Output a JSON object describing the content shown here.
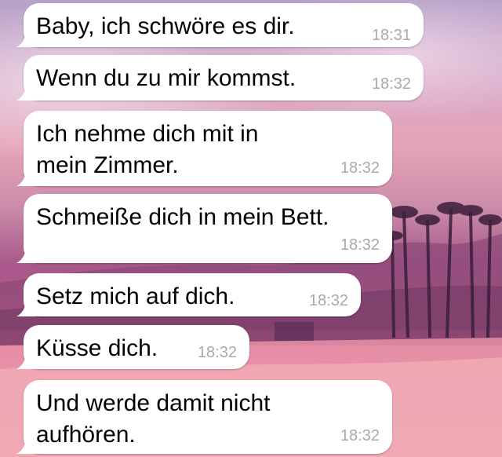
{
  "chat": {
    "messages": [
      {
        "text": "Baby, ich schwöre es dir.",
        "time": "18:31"
      },
      {
        "text": "Wenn du zu mir kommst.",
        "time": "18:32"
      },
      {
        "text": "Ich nehme dich mit in mein Zimmer.",
        "time": "18:32"
      },
      {
        "text": "Schmeiße dich in mein Bett.",
        "time": "18:32"
      },
      {
        "text": "Setz mich auf dich.",
        "time": "18:32"
      },
      {
        "text": "Küsse dich.",
        "time": "18:32"
      },
      {
        "text": "Und werde damit nicht aufhören.",
        "time": "18:32"
      }
    ]
  },
  "wallpaper": {
    "description_colors": [
      "#e6a4b8",
      "#a7578a",
      "#f1a1ab"
    ]
  }
}
